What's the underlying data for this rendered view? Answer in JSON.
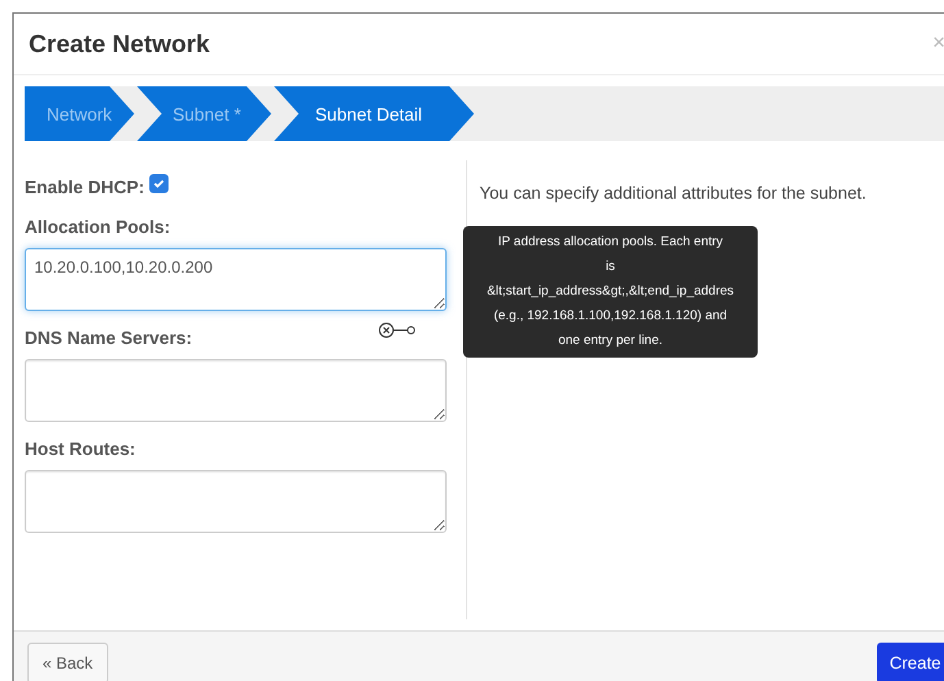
{
  "dialog": {
    "title": "Create Network",
    "close": "×"
  },
  "steps": [
    {
      "label": "Network",
      "selected": false
    },
    {
      "label": "Subnet *",
      "selected": false
    },
    {
      "label": "Subnet Detail",
      "selected": true
    }
  ],
  "form": {
    "fields": [
      {
        "kind": "checkbox",
        "label": "Enable DHCP:",
        "checked": true
      },
      {
        "kind": "textarea",
        "label": "Allocation Pools:",
        "value": "10.20.0.100,10.20.0.200",
        "focused": true
      },
      {
        "kind": "textarea",
        "label": "DNS Name Servers:",
        "focused": false
      },
      {
        "kind": "textarea",
        "label": "Host Routes:",
        "focused": false
      }
    ]
  },
  "help": "You can specify additional attributes for the subnet.",
  "tooltip": [
    "IP address allocation pools. Each entry",
    "is",
    "&lt;start_ip_address&gt;,&lt;end_ip_addres",
    "(e.g., 192.168.1.100,192.168.1.120) and",
    "one entry per line."
  ],
  "buttons": {
    "back": "« Back",
    "create": "Create"
  }
}
